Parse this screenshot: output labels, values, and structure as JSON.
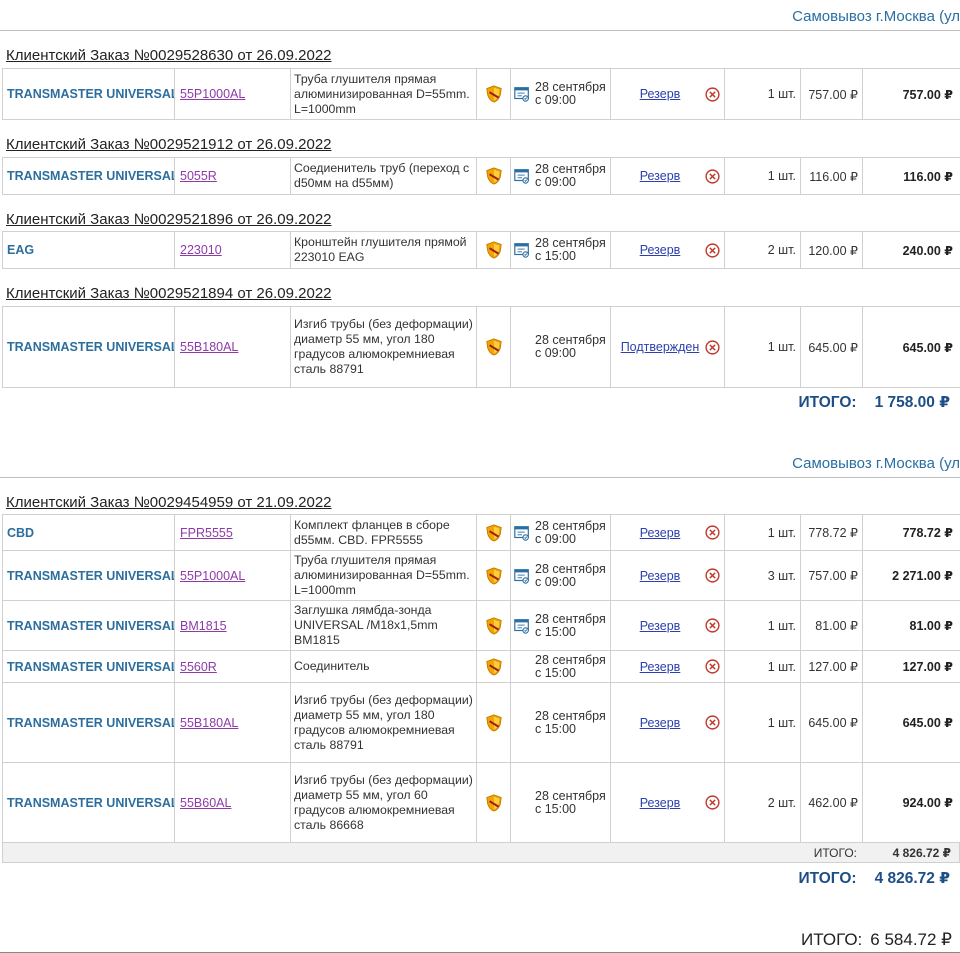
{
  "pickup_label": "Самовывоз г.Москва (ул",
  "currency": "₽",
  "groups": [
    {
      "orders": [
        {
          "title": "Клиентский Заказ №0029528630 от 26.09.2022",
          "rows": [
            {
              "brand": "TRANSMASTER UNIVERSAL",
              "article": "55P1000AL",
              "desc": "Труба глушителя прямая алюминизированная D=55mm. L=1000mm",
              "has_delivery_icon": true,
              "date": "28 сентября с 09:00",
              "status": "Резерв",
              "qty": "1 шт.",
              "price": "757.00 ₽",
              "sum": "757.00 ₽"
            }
          ]
        },
        {
          "title": "Клиентский Заказ №0029521912 от 26.09.2022",
          "rows": [
            {
              "brand": "TRANSMASTER UNIVERSAL",
              "article": "5055R",
              "desc": "Соедиенитель труб (переход с d50мм на d55мм)",
              "has_delivery_icon": true,
              "date": "28 сентября с 09:00",
              "status": "Резерв",
              "qty": "1 шт.",
              "price": "116.00 ₽",
              "sum": "116.00 ₽"
            }
          ]
        },
        {
          "title": "Клиентский Заказ №0029521896 от 26.09.2022",
          "rows": [
            {
              "brand": "EAG",
              "article": "223010",
              "desc": "Кронштейн глушителя прямой 223010 EAG",
              "has_delivery_icon": true,
              "date": "28 сентября с 15:00",
              "status": "Резерв",
              "qty": "2 шт.",
              "price": "120.00 ₽",
              "sum": "240.00 ₽"
            }
          ]
        },
        {
          "title": "Клиентский Заказ №0029521894 от 26.09.2022",
          "rows": [
            {
              "brand": "TRANSMASTER UNIVERSAL",
              "article": "55B180AL",
              "desc": "Изгиб трубы (без деформации) диаметр 55 мм, угол 180 градусов алюмокремниевая сталь 88791",
              "has_delivery_icon": false,
              "date": "28 сентября с 09:00",
              "status": "Подтвержден",
              "qty": "1 шт.",
              "price": "645.00 ₽",
              "sum": "645.00 ₽"
            }
          ]
        }
      ],
      "itogo_label": "ИТОГО:",
      "itogo_value": "1 758.00 ₽"
    },
    {
      "orders": [
        {
          "title": "Клиентский Заказ №0029454959 от 21.09.2022",
          "rows": [
            {
              "brand": "CBD",
              "article": "FPR5555",
              "desc": "Комплект фланцев в сборе d55мм. CBD. FPR5555",
              "has_delivery_icon": true,
              "date": "28 сентября с 09:00",
              "status": "Резерв",
              "qty": "1 шт.",
              "price": "778.72 ₽",
              "sum": "778.72 ₽"
            },
            {
              "brand": "TRANSMASTER UNIVERSAL",
              "article": "55P1000AL",
              "desc": "Труба глушителя прямая алюминизированная D=55mm. L=1000mm",
              "has_delivery_icon": true,
              "date": "28 сентября с 09:00",
              "status": "Резерв",
              "qty": "3 шт.",
              "price": "757.00 ₽",
              "sum": "2 271.00 ₽"
            },
            {
              "brand": "TRANSMASTER UNIVERSAL",
              "article": "BM1815",
              "desc": "Заглушка лямбда-зонда UNIVERSAL /M18x1,5mm BM1815",
              "has_delivery_icon": true,
              "date": "28 сентября с 15:00",
              "status": "Резерв",
              "qty": "1 шт.",
              "price": "81.00 ₽",
              "sum": "81.00 ₽"
            },
            {
              "brand": "TRANSMASTER UNIVERSAL",
              "article": "5560R",
              "desc": "Соединитель",
              "has_delivery_icon": false,
              "date": "28 сентября с 15:00",
              "status": "Резерв",
              "qty": "1 шт.",
              "price": "127.00 ₽",
              "sum": "127.00 ₽"
            },
            {
              "brand": "TRANSMASTER UNIVERSAL",
              "article": "55B180AL",
              "desc": "Изгиб трубы (без деформации) диаметр 55 мм, угол 180 градусов алюмокремниевая сталь 88791",
              "has_delivery_icon": false,
              "date": "28 сентября с 15:00",
              "status": "Резерв",
              "qty": "1 шт.",
              "price": "645.00 ₽",
              "sum": "645.00 ₽"
            },
            {
              "brand": "TRANSMASTER UNIVERSAL",
              "article": "55B60AL",
              "desc": "Изгиб трубы (без деформации) диаметр 55 мм, угол 60 градусов алюмокремниевая сталь 86668",
              "has_delivery_icon": false,
              "date": "28 сентября с 15:00",
              "status": "Резерв",
              "qty": "2 шт.",
              "price": "462.00 ₽",
              "sum": "924.00 ₽"
            }
          ],
          "subtotal_label": "ИТОГО:",
          "subtotal_value": "4 826.72 ₽"
        }
      ],
      "itogo_label": "ИТОГО:",
      "itogo_value": "4 826.72 ₽"
    }
  ],
  "grand_total_label": "ИТОГО:",
  "grand_total_value": "6 584.72 ₽",
  "icons": {
    "shield": "warranty-shield-icon",
    "delivery": "delivery-certificate-icon",
    "cancel": "cancel-circle-icon"
  },
  "colors": {
    "brand": "#2c6e9e",
    "article": "#8e3aa8",
    "status": "#2b3fae",
    "itogo": "#1e4e86",
    "cancel": "#c0392b",
    "shield": "#f0a500"
  }
}
